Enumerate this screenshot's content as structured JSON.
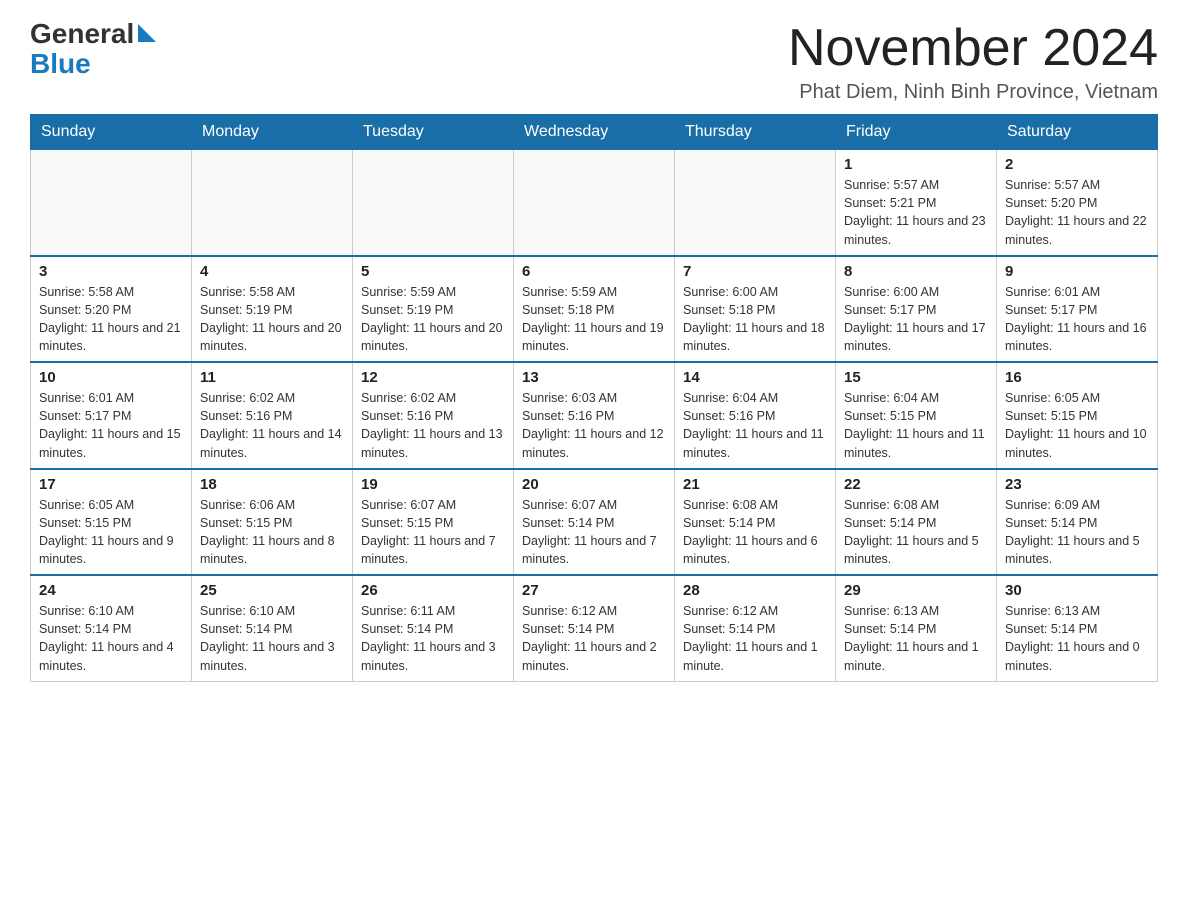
{
  "logo": {
    "general": "General",
    "blue": "Blue"
  },
  "title": "November 2024",
  "subtitle": "Phat Diem, Ninh Binh Province, Vietnam",
  "weekdays": [
    "Sunday",
    "Monday",
    "Tuesday",
    "Wednesday",
    "Thursday",
    "Friday",
    "Saturday"
  ],
  "weeks": [
    [
      {
        "day": "",
        "info": ""
      },
      {
        "day": "",
        "info": ""
      },
      {
        "day": "",
        "info": ""
      },
      {
        "day": "",
        "info": ""
      },
      {
        "day": "",
        "info": ""
      },
      {
        "day": "1",
        "info": "Sunrise: 5:57 AM\nSunset: 5:21 PM\nDaylight: 11 hours and 23 minutes."
      },
      {
        "day": "2",
        "info": "Sunrise: 5:57 AM\nSunset: 5:20 PM\nDaylight: 11 hours and 22 minutes."
      }
    ],
    [
      {
        "day": "3",
        "info": "Sunrise: 5:58 AM\nSunset: 5:20 PM\nDaylight: 11 hours and 21 minutes."
      },
      {
        "day": "4",
        "info": "Sunrise: 5:58 AM\nSunset: 5:19 PM\nDaylight: 11 hours and 20 minutes."
      },
      {
        "day": "5",
        "info": "Sunrise: 5:59 AM\nSunset: 5:19 PM\nDaylight: 11 hours and 20 minutes."
      },
      {
        "day": "6",
        "info": "Sunrise: 5:59 AM\nSunset: 5:18 PM\nDaylight: 11 hours and 19 minutes."
      },
      {
        "day": "7",
        "info": "Sunrise: 6:00 AM\nSunset: 5:18 PM\nDaylight: 11 hours and 18 minutes."
      },
      {
        "day": "8",
        "info": "Sunrise: 6:00 AM\nSunset: 5:17 PM\nDaylight: 11 hours and 17 minutes."
      },
      {
        "day": "9",
        "info": "Sunrise: 6:01 AM\nSunset: 5:17 PM\nDaylight: 11 hours and 16 minutes."
      }
    ],
    [
      {
        "day": "10",
        "info": "Sunrise: 6:01 AM\nSunset: 5:17 PM\nDaylight: 11 hours and 15 minutes."
      },
      {
        "day": "11",
        "info": "Sunrise: 6:02 AM\nSunset: 5:16 PM\nDaylight: 11 hours and 14 minutes."
      },
      {
        "day": "12",
        "info": "Sunrise: 6:02 AM\nSunset: 5:16 PM\nDaylight: 11 hours and 13 minutes."
      },
      {
        "day": "13",
        "info": "Sunrise: 6:03 AM\nSunset: 5:16 PM\nDaylight: 11 hours and 12 minutes."
      },
      {
        "day": "14",
        "info": "Sunrise: 6:04 AM\nSunset: 5:16 PM\nDaylight: 11 hours and 11 minutes."
      },
      {
        "day": "15",
        "info": "Sunrise: 6:04 AM\nSunset: 5:15 PM\nDaylight: 11 hours and 11 minutes."
      },
      {
        "day": "16",
        "info": "Sunrise: 6:05 AM\nSunset: 5:15 PM\nDaylight: 11 hours and 10 minutes."
      }
    ],
    [
      {
        "day": "17",
        "info": "Sunrise: 6:05 AM\nSunset: 5:15 PM\nDaylight: 11 hours and 9 minutes."
      },
      {
        "day": "18",
        "info": "Sunrise: 6:06 AM\nSunset: 5:15 PM\nDaylight: 11 hours and 8 minutes."
      },
      {
        "day": "19",
        "info": "Sunrise: 6:07 AM\nSunset: 5:15 PM\nDaylight: 11 hours and 7 minutes."
      },
      {
        "day": "20",
        "info": "Sunrise: 6:07 AM\nSunset: 5:14 PM\nDaylight: 11 hours and 7 minutes."
      },
      {
        "day": "21",
        "info": "Sunrise: 6:08 AM\nSunset: 5:14 PM\nDaylight: 11 hours and 6 minutes."
      },
      {
        "day": "22",
        "info": "Sunrise: 6:08 AM\nSunset: 5:14 PM\nDaylight: 11 hours and 5 minutes."
      },
      {
        "day": "23",
        "info": "Sunrise: 6:09 AM\nSunset: 5:14 PM\nDaylight: 11 hours and 5 minutes."
      }
    ],
    [
      {
        "day": "24",
        "info": "Sunrise: 6:10 AM\nSunset: 5:14 PM\nDaylight: 11 hours and 4 minutes."
      },
      {
        "day": "25",
        "info": "Sunrise: 6:10 AM\nSunset: 5:14 PM\nDaylight: 11 hours and 3 minutes."
      },
      {
        "day": "26",
        "info": "Sunrise: 6:11 AM\nSunset: 5:14 PM\nDaylight: 11 hours and 3 minutes."
      },
      {
        "day": "27",
        "info": "Sunrise: 6:12 AM\nSunset: 5:14 PM\nDaylight: 11 hours and 2 minutes."
      },
      {
        "day": "28",
        "info": "Sunrise: 6:12 AM\nSunset: 5:14 PM\nDaylight: 11 hours and 1 minute."
      },
      {
        "day": "29",
        "info": "Sunrise: 6:13 AM\nSunset: 5:14 PM\nDaylight: 11 hours and 1 minute."
      },
      {
        "day": "30",
        "info": "Sunrise: 6:13 AM\nSunset: 5:14 PM\nDaylight: 11 hours and 0 minutes."
      }
    ]
  ]
}
